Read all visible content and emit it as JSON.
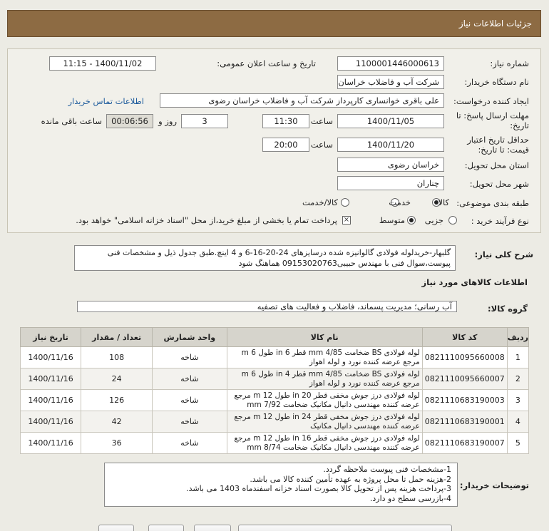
{
  "header": {
    "title": "جزئیات اطلاعات نیاز"
  },
  "form": {
    "need_number_label": "شماره نیاز:",
    "need_number": "1100001446000613",
    "announce_label": "تاریخ و ساعت اعلان عمومی:",
    "announce_value": "1400/11/02 - 11:15",
    "buyer_label": "نام دستگاه خریدار:",
    "buyer_value": "شرکت آب و فاضلاب خراسان رضوی",
    "requester_label": "ایجاد کننده درخواست:",
    "requester_value": "علی باقری خوانساری کارپرداز شرکت آب و فاضلاب خراسان رضوی",
    "contact_link": "اطلاعات تماس خریدار",
    "deadline_label_1": "مهلت ارسال پاسخ: تا",
    "deadline_label_2": "تاریخ:",
    "deadline_date": "1400/11/05",
    "time_label": "ساعت",
    "deadline_time": "11:30",
    "days_value": "3",
    "days_label": "روز و",
    "remaining_value": "00:06:56",
    "remaining_label": "ساعت باقی مانده",
    "validity_label_1": "حداقل تاریخ اعتبار",
    "validity_label_2": "قیمت: تا تاریخ:",
    "validity_date": "1400/11/20",
    "validity_time": "20:00",
    "province_label": "استان محل تحویل:",
    "province_value": "خراسان رضوی",
    "city_label": "شهر محل تحویل:",
    "city_value": "چناران",
    "category_label": "طبقه بندی موضوعی:",
    "category_options": [
      "کالا",
      "خدمت",
      "کالا/خدمت"
    ],
    "category_selected": "کالا",
    "process_label": "نوع فرآیند خرید :",
    "process_options": [
      "جزیی",
      "متوسط"
    ],
    "process_selected": "متوسط",
    "payment_note": "پرداخت تمام یا بخشی از مبلغ خرید،از محل \"اسناد خزانه اسلامی\" خواهد بود."
  },
  "description": {
    "label": "شرح کلی نیاز:",
    "text": "گلبهار-خریدلوله فولادی گالوانیزه شده درسایزهای 24-20-16-6 و 4 اینچ.طبق جدول ذیل و مشخصات فنی پیوست،سوال فنی با مهندس حبیبی09153020763 هماهنگ شود"
  },
  "goods": {
    "section_title": "اطلاعات کالاهای مورد نیاز",
    "group_label": "گروه کالا:",
    "group_value": "آب رسانی؛ مدیریت پسماند، فاضلاب و فعالیت های تصفیه",
    "columns": [
      "ردیف",
      "کد کالا",
      "نام کالا",
      "واحد شمارش",
      "تعداد / مقدار",
      "تاریخ نیاز"
    ],
    "rows": [
      {
        "no": "1",
        "code": "0821110095660008",
        "name": "لوله فولادی BS ضخامت 4/85 mm قطر 6 in طول 6 m مرجع عرضه کننده نورد و لوله اهواز",
        "unit": "شاخه",
        "qty": "108",
        "date": "1400/11/16"
      },
      {
        "no": "2",
        "code": "0821110095660007",
        "name": "لوله فولادی BS ضخامت 4/85 mm قطر 4 in طول 6 m مرجع عرضه کننده نورد و لوله اهواز",
        "unit": "شاخه",
        "qty": "24",
        "date": "1400/11/16"
      },
      {
        "no": "3",
        "code": "0821110683190003",
        "name": "لوله فولادی درز جوش مخفی قطر 20 in طول 12 m مرجع عرضه کننده مهندسی دانیال مکانیک ضخامت 7/92 mm",
        "unit": "شاخه",
        "qty": "126",
        "date": "1400/11/16"
      },
      {
        "no": "4",
        "code": "0821110683190001",
        "name": "لوله فولادی درز جوش مخفی قطر 24 in طول 12 m مرجع عرضه کننده مهندسی دانیال مکانیک",
        "unit": "شاخه",
        "qty": "42",
        "date": "1400/11/16"
      },
      {
        "no": "5",
        "code": "0821110683190007",
        "name": "لوله فولادی درز جوش مخفی قطر 16 in طول 12 m مرجع عرضه کننده مهندسی دانیال مکانیک ضخامت 8/74 mm",
        "unit": "شاخه",
        "qty": "36",
        "date": "1400/11/16"
      }
    ]
  },
  "buyer_notes": {
    "label": "توضیحات خریدار:",
    "lines": [
      "1-مشخصات فنی پیوست ملاحظه گردد.",
      "2-هزینه حمل تا محل پروژه به عهده تأمین کننده کالا می باشد.",
      "3-پرداخت هزینه پس از تحویل کالا بصورت اسناد خزانه اسفندماه 1403 می باشد.",
      "4-بازرسی سطح دو دارد."
    ]
  }
}
